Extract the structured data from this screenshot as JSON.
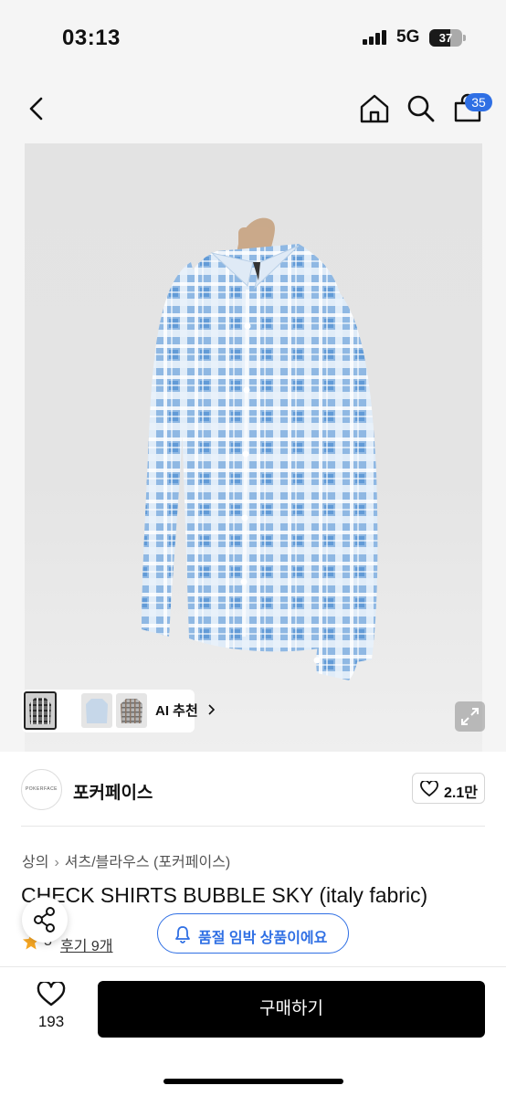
{
  "status_bar": {
    "time": "03:13",
    "network": "5G",
    "battery": "37"
  },
  "nav": {
    "cart_count": "35"
  },
  "gallery": {
    "ai_recommend_label": "AI 추천",
    "thumbnails": [
      "plaid-dark-shirt",
      "light-blue-shirt",
      "gray-check-shirt"
    ]
  },
  "shop": {
    "logo_text": "POKERFACE",
    "name": "포커페이스",
    "likes": "2.1만"
  },
  "breadcrumb": {
    "category": "상의",
    "subcategory": "셔츠/블라우스 (포커페이스)"
  },
  "product": {
    "title": "CHECK SHIRTS BUBBLE SKY (italy fabric)",
    "rating": "5",
    "reviews": "후기 9개"
  },
  "stock_banner": {
    "text": "품절 임박 상품이에요"
  },
  "bottom": {
    "wish_count": "193",
    "buy_label": "구매하기"
  },
  "colors": {
    "accent": "#2f6fe4",
    "buy_button": "#000000",
    "star": "#f5a623"
  }
}
